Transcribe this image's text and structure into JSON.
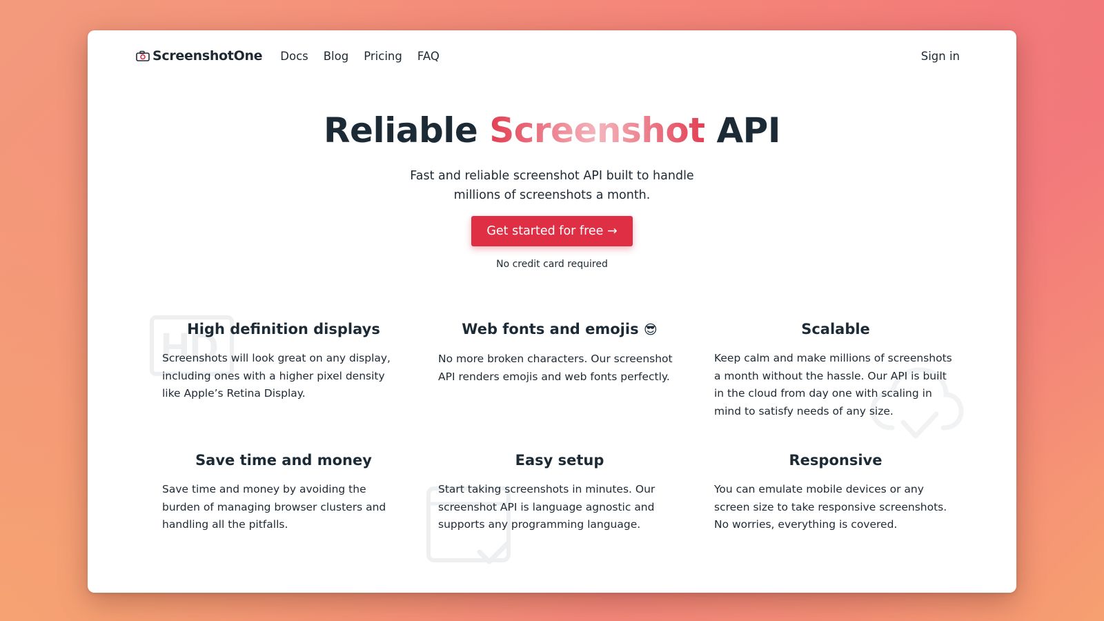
{
  "brand": {
    "name": "ScreenshotOne",
    "icon": "camera-logo-icon"
  },
  "nav": {
    "links": [
      "Docs",
      "Blog",
      "Pricing",
      "FAQ"
    ],
    "signin": "Sign in"
  },
  "hero": {
    "title_before": "Reliable ",
    "title_accent": "Screenshot",
    "title_after": " API",
    "subtitle": "Fast and reliable screenshot API built to handle millions of screenshots a month.",
    "cta": "Get started for free →",
    "cta_note": "No credit card required"
  },
  "features": [
    {
      "title": "High definition displays",
      "emoji": "",
      "text": "Screenshots will look great on any display, including ones with a higher pixel density like Apple’s Retina Display.",
      "icon": "hd-icon"
    },
    {
      "title": "Web fonts and emojis ",
      "emoji": "😎",
      "text": "No more broken characters. Our screenshot API renders emojis and web fonts perfectly.",
      "icon": ""
    },
    {
      "title": "Scalable",
      "emoji": "",
      "text": "Keep calm and make millions of screenshots a month without the hassle. Our API is built in the cloud from day one with scaling in mind to satisfy needs of any size.",
      "icon": "cloud-check-icon"
    },
    {
      "title": "Save time and money",
      "emoji": "",
      "text": "Save time and money by avoiding the burden of managing browser clusters and handling all the pitfalls.",
      "icon": ""
    },
    {
      "title": "Easy setup",
      "emoji": "",
      "text": "Start taking screenshots in minutes. Our screenshot API is language agnostic and supports any programming language.",
      "icon": "window-check-icon"
    },
    {
      "title": "Responsive",
      "emoji": "",
      "text": "You can emulate mobile devices or any screen size to take responsive screenshots. No worries, everything is covered.",
      "icon": ""
    }
  ],
  "colors": {
    "accent": "#df2f45",
    "text_dark": "#1c2a36",
    "background_gradient_start": "#f39a7c",
    "background_gradient_end": "#f47e7d"
  }
}
